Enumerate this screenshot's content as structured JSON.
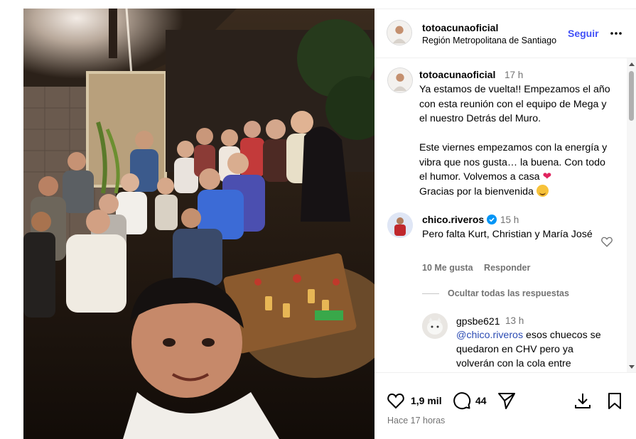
{
  "post": {
    "author": "totoacunaoficial",
    "location": "Región Metropolitana de Santiago",
    "follow_label": "Seguir",
    "more_icon": "more-horizontal-icon"
  },
  "caption": {
    "author": "totoacunaoficial",
    "time": "17 h",
    "paragraph1": "Ya estamos de vuelta!! Empezamos el año con esta reunión con el equipo de Mega y el nuestro Detrás del Muro.",
    "paragraph2_text": "Este viernes empezamos con la energía y vibra que nos gusta… la buena. Con todo el humor. Volvemos a casa",
    "paragraph2_emoji": "❤",
    "paragraph3_text": "Gracias por la bienvenida",
    "paragraph3_emoji_icon": "hugging-face-emoji"
  },
  "comment": {
    "author": "chico.riveros",
    "verified_icon": "verified-badge-icon",
    "time": "15 h",
    "text": "Pero falta Kurt, Christian y María José",
    "likes": "10 Me gusta",
    "reply_label": "Responder",
    "hide_replies": "Ocultar todas las respuestas"
  },
  "reply": {
    "author": "gpsbe621",
    "time": "13 h",
    "mention": "@chico.riveros",
    "text": " esos chuecos se quedaron en CHV pero ya volverán con la cola entre"
  },
  "actions": {
    "like_count": "1,9 mil",
    "comment_count": "44",
    "timestamp": "Hace 17 horas"
  },
  "colors": {
    "follow": "#4150f7",
    "muted": "#737373",
    "verified": "#0095f6",
    "heart": "#e0245e"
  }
}
